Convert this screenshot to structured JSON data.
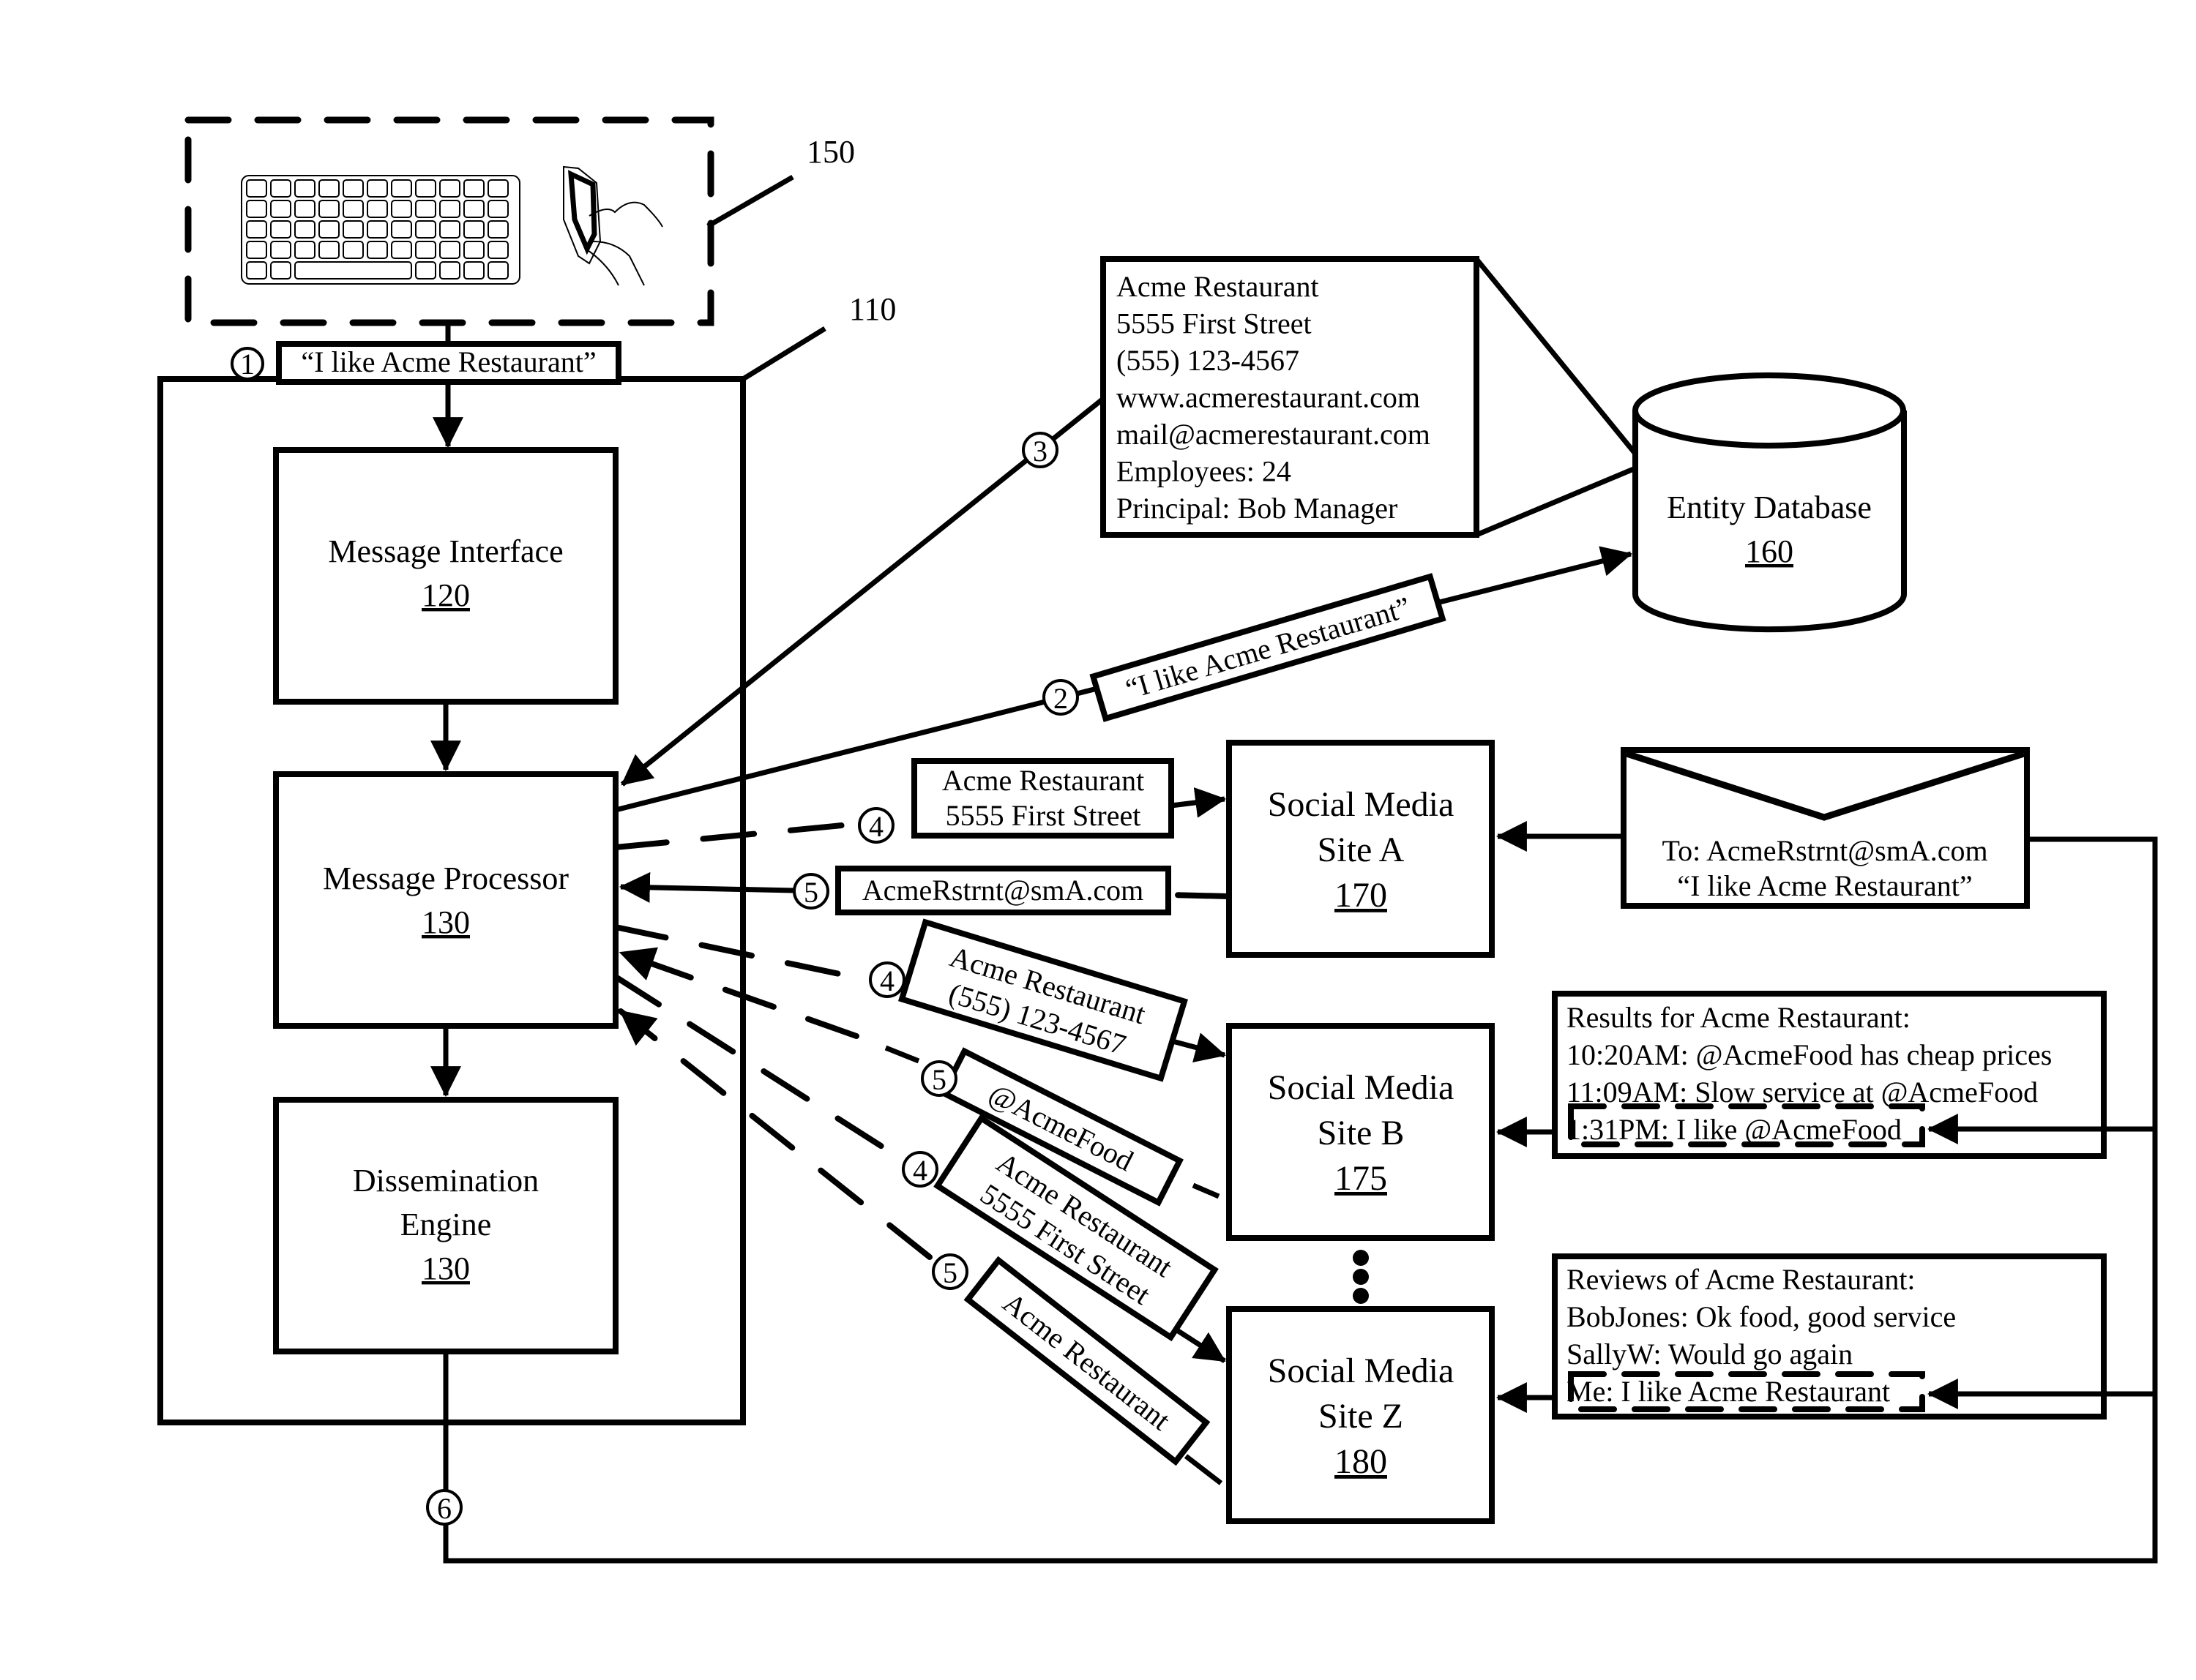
{
  "figure": {
    "ref_input_devices": "150",
    "ref_system": "110"
  },
  "steps": {
    "s1": "1",
    "s2": "2",
    "s3": "3",
    "s4": "4",
    "s5": "5",
    "s6": "6"
  },
  "messages": {
    "input_message": "“I like Acme Restaurant”",
    "to_entity_db": "“I like Acme Restaurant”"
  },
  "components": {
    "message_interface": {
      "name": "Message Interface",
      "ref": "120"
    },
    "message_processor": {
      "name": "Message Processor",
      "ref": "130"
    },
    "dissemination_engine": {
      "name_line1": "Dissemination",
      "name_line2": "Engine",
      "ref": "130"
    },
    "entity_database": {
      "name": "Entity Database",
      "ref": "160"
    },
    "site_a": {
      "line1": "Social Media",
      "line2": "Site A",
      "ref": "170"
    },
    "site_b": {
      "line1": "Social Media",
      "line2": "Site B",
      "ref": "175"
    },
    "site_z": {
      "line1": "Social Media",
      "line2": "Site Z",
      "ref": "180"
    }
  },
  "entity_record": [
    "Acme Restaurant",
    "5555 First Street",
    "(555) 123-4567",
    "www.acmerestaurant.com",
    "mail@acmerestaurant.com",
    "Employees: 24",
    "Principal: Bob Manager"
  ],
  "queries": {
    "site_a_query": [
      "Acme Restaurant",
      "5555 First Street"
    ],
    "site_a_result": "AcmeRstrnt@smA.com",
    "site_b_query": [
      "Acme Restaurant",
      "(555) 123-4567"
    ],
    "site_b_result": "@AcmeFood",
    "site_z_query": [
      "Acme Restaurant",
      "5555 First Street"
    ],
    "site_z_result": "Acme Restaurant"
  },
  "outputs": {
    "email": [
      "To: AcmeRstrnt@smA.com",
      "“I like Acme Restaurant”"
    ],
    "site_b_results": [
      "Results for Acme Restaurant:",
      "10:20AM: @AcmeFood has cheap prices",
      "11:09AM: Slow service at @AcmeFood",
      "1:31PM: I like @AcmeFood"
    ],
    "site_z_reviews": [
      "Reviews of Acme Restaurant:",
      "BobJones: Ok food, good service",
      "SallyW: Would go again",
      "Me: I like Acme Restaurant"
    ]
  }
}
